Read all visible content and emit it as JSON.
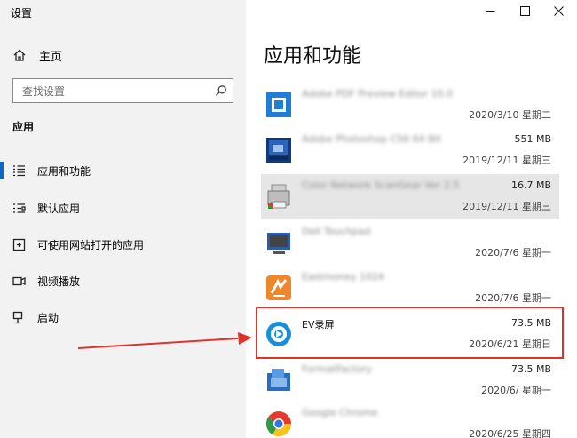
{
  "window": {
    "title": "设置",
    "controls": [
      "minimize",
      "maximize",
      "close"
    ]
  },
  "sidebar": {
    "home_label": "主页",
    "search_placeholder": "查找设置",
    "section_title": "应用",
    "items": [
      {
        "label": "应用和功能",
        "icon": "apps-list-icon",
        "selected": true
      },
      {
        "label": "默认应用",
        "icon": "default-apps-icon",
        "selected": false
      },
      {
        "label": "可使用网站打开的应用",
        "icon": "website-app-icon",
        "selected": false
      },
      {
        "label": "视频播放",
        "icon": "video-camera-icon",
        "selected": false
      },
      {
        "label": "启动",
        "icon": "startup-icon",
        "selected": false
      }
    ]
  },
  "main": {
    "heading": "应用和功能",
    "apps": [
      {
        "name": "Adobe PDF Preview Editor 10.0",
        "size": "",
        "date": "2020/3/10 星期二",
        "blurred": true
      },
      {
        "name": "Adobe Photoshop CS6 64 Bit",
        "size": "551 MB",
        "date": "2019/12/11 星期三",
        "blurred": true
      },
      {
        "name": "Color Network ScanGear Ver 2.5",
        "size": "16.7 MB",
        "date": "2019/12/11 星期三",
        "blurred": true
      },
      {
        "name": "Dell Touchpad",
        "size": "",
        "date": "2020/7/6 星期一",
        "blurred": true
      },
      {
        "name": "Eastmoney 1024",
        "size": "",
        "date": "2020/7/6 星期一",
        "blurred": true
      },
      {
        "name": "EV录屏",
        "size": "73.5 MB",
        "date": "2020/6/21 星期日",
        "blurred": false
      },
      {
        "name": "FormatFactory",
        "size": "73.5 MB",
        "date": "2020/6/ 星期一",
        "blurred": true
      },
      {
        "name": "Google Chrome",
        "size": "",
        "date": "2020/6/25 星期四",
        "blurred": true
      }
    ]
  },
  "colors": {
    "accent": "#0b68c7",
    "highlight_box": "#e0322b",
    "sidebar_bg": "#f2f2f2",
    "selected_row_bg": "#e6e6e6"
  }
}
